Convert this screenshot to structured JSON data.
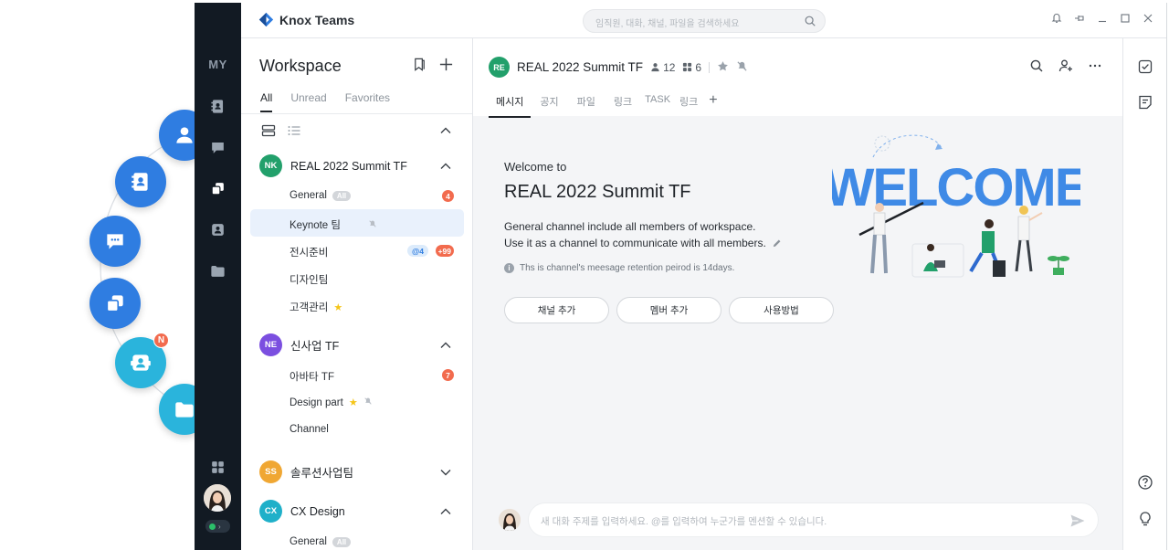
{
  "app": {
    "title": "Knox Teams"
  },
  "search": {
    "placeholder": "임직원, 대화, 채널, 파일을 검색하세요"
  },
  "rail": {
    "my_label": "MY"
  },
  "floating": {
    "badge_n": "N"
  },
  "workspace": {
    "title": "Workspace",
    "tabs": [
      {
        "label": "All",
        "active": true
      },
      {
        "label": "Unread",
        "active": false
      },
      {
        "label": "Favorites",
        "active": false
      }
    ],
    "groups": [
      {
        "initials": "NK",
        "name": "REAL 2022 Summit TF",
        "color": "#22a06b",
        "expanded": true,
        "channels": [
          {
            "name": "General",
            "all_badge": "All",
            "count": "4"
          },
          {
            "name": "Keynote 팀",
            "muted": true,
            "selected": true
          },
          {
            "name": "전시준비",
            "mention": "@4",
            "count": "+99"
          },
          {
            "name": "디자인팀"
          },
          {
            "name": "고객관리",
            "favorite": true
          }
        ]
      },
      {
        "initials": "NE",
        "name": "신사업 TF",
        "color": "#7b4fe0",
        "expanded": true,
        "channels": [
          {
            "name": "아바타 TF",
            "count": "7"
          },
          {
            "name": "Design part",
            "favorite": true,
            "muted": true
          },
          {
            "name": "Channel"
          }
        ]
      },
      {
        "initials": "SS",
        "name": "솔루션사업팀",
        "color": "#f0a733",
        "expanded": false
      },
      {
        "initials": "CX",
        "name": "CX Design",
        "color": "#1fb0c9",
        "expanded": true,
        "channels": [
          {
            "name": "General",
            "all_badge": "All"
          }
        ]
      }
    ]
  },
  "channel": {
    "initials": "RE",
    "title": "REAL 2022 Summit TF",
    "members": "12",
    "apps": "6",
    "tabs": [
      {
        "label": "메시지",
        "active": true
      },
      {
        "label": "공지"
      },
      {
        "label": "파일"
      },
      {
        "label": "링크"
      },
      {
        "label": "TASK"
      },
      {
        "label": "링크"
      }
    ],
    "welcome": {
      "sub": "Welcome to",
      "title": "REAL 2022 Summit TF",
      "desc_line1": "General channel include all members of workspace.",
      "desc_line2": "Use it as a channel to communicate with all members.",
      "retention": "Ths is channel's meesage retention peirod is 14days.",
      "buttons": [
        "채널 추가",
        "멤버 추가",
        "사용방법"
      ],
      "art_word": "WELCOME"
    },
    "composer": {
      "placeholder": "새 대화 주제를 입력하세요. @를 입력하여 누군가를 멘션할 수 있습니다."
    }
  },
  "colors": {
    "accent": "#2f7de1",
    "bubble_cyan": "#2ab4dc",
    "rail_bg": "#121a23",
    "badge_red": "#f26b4e",
    "online": "#2bbf6a"
  }
}
